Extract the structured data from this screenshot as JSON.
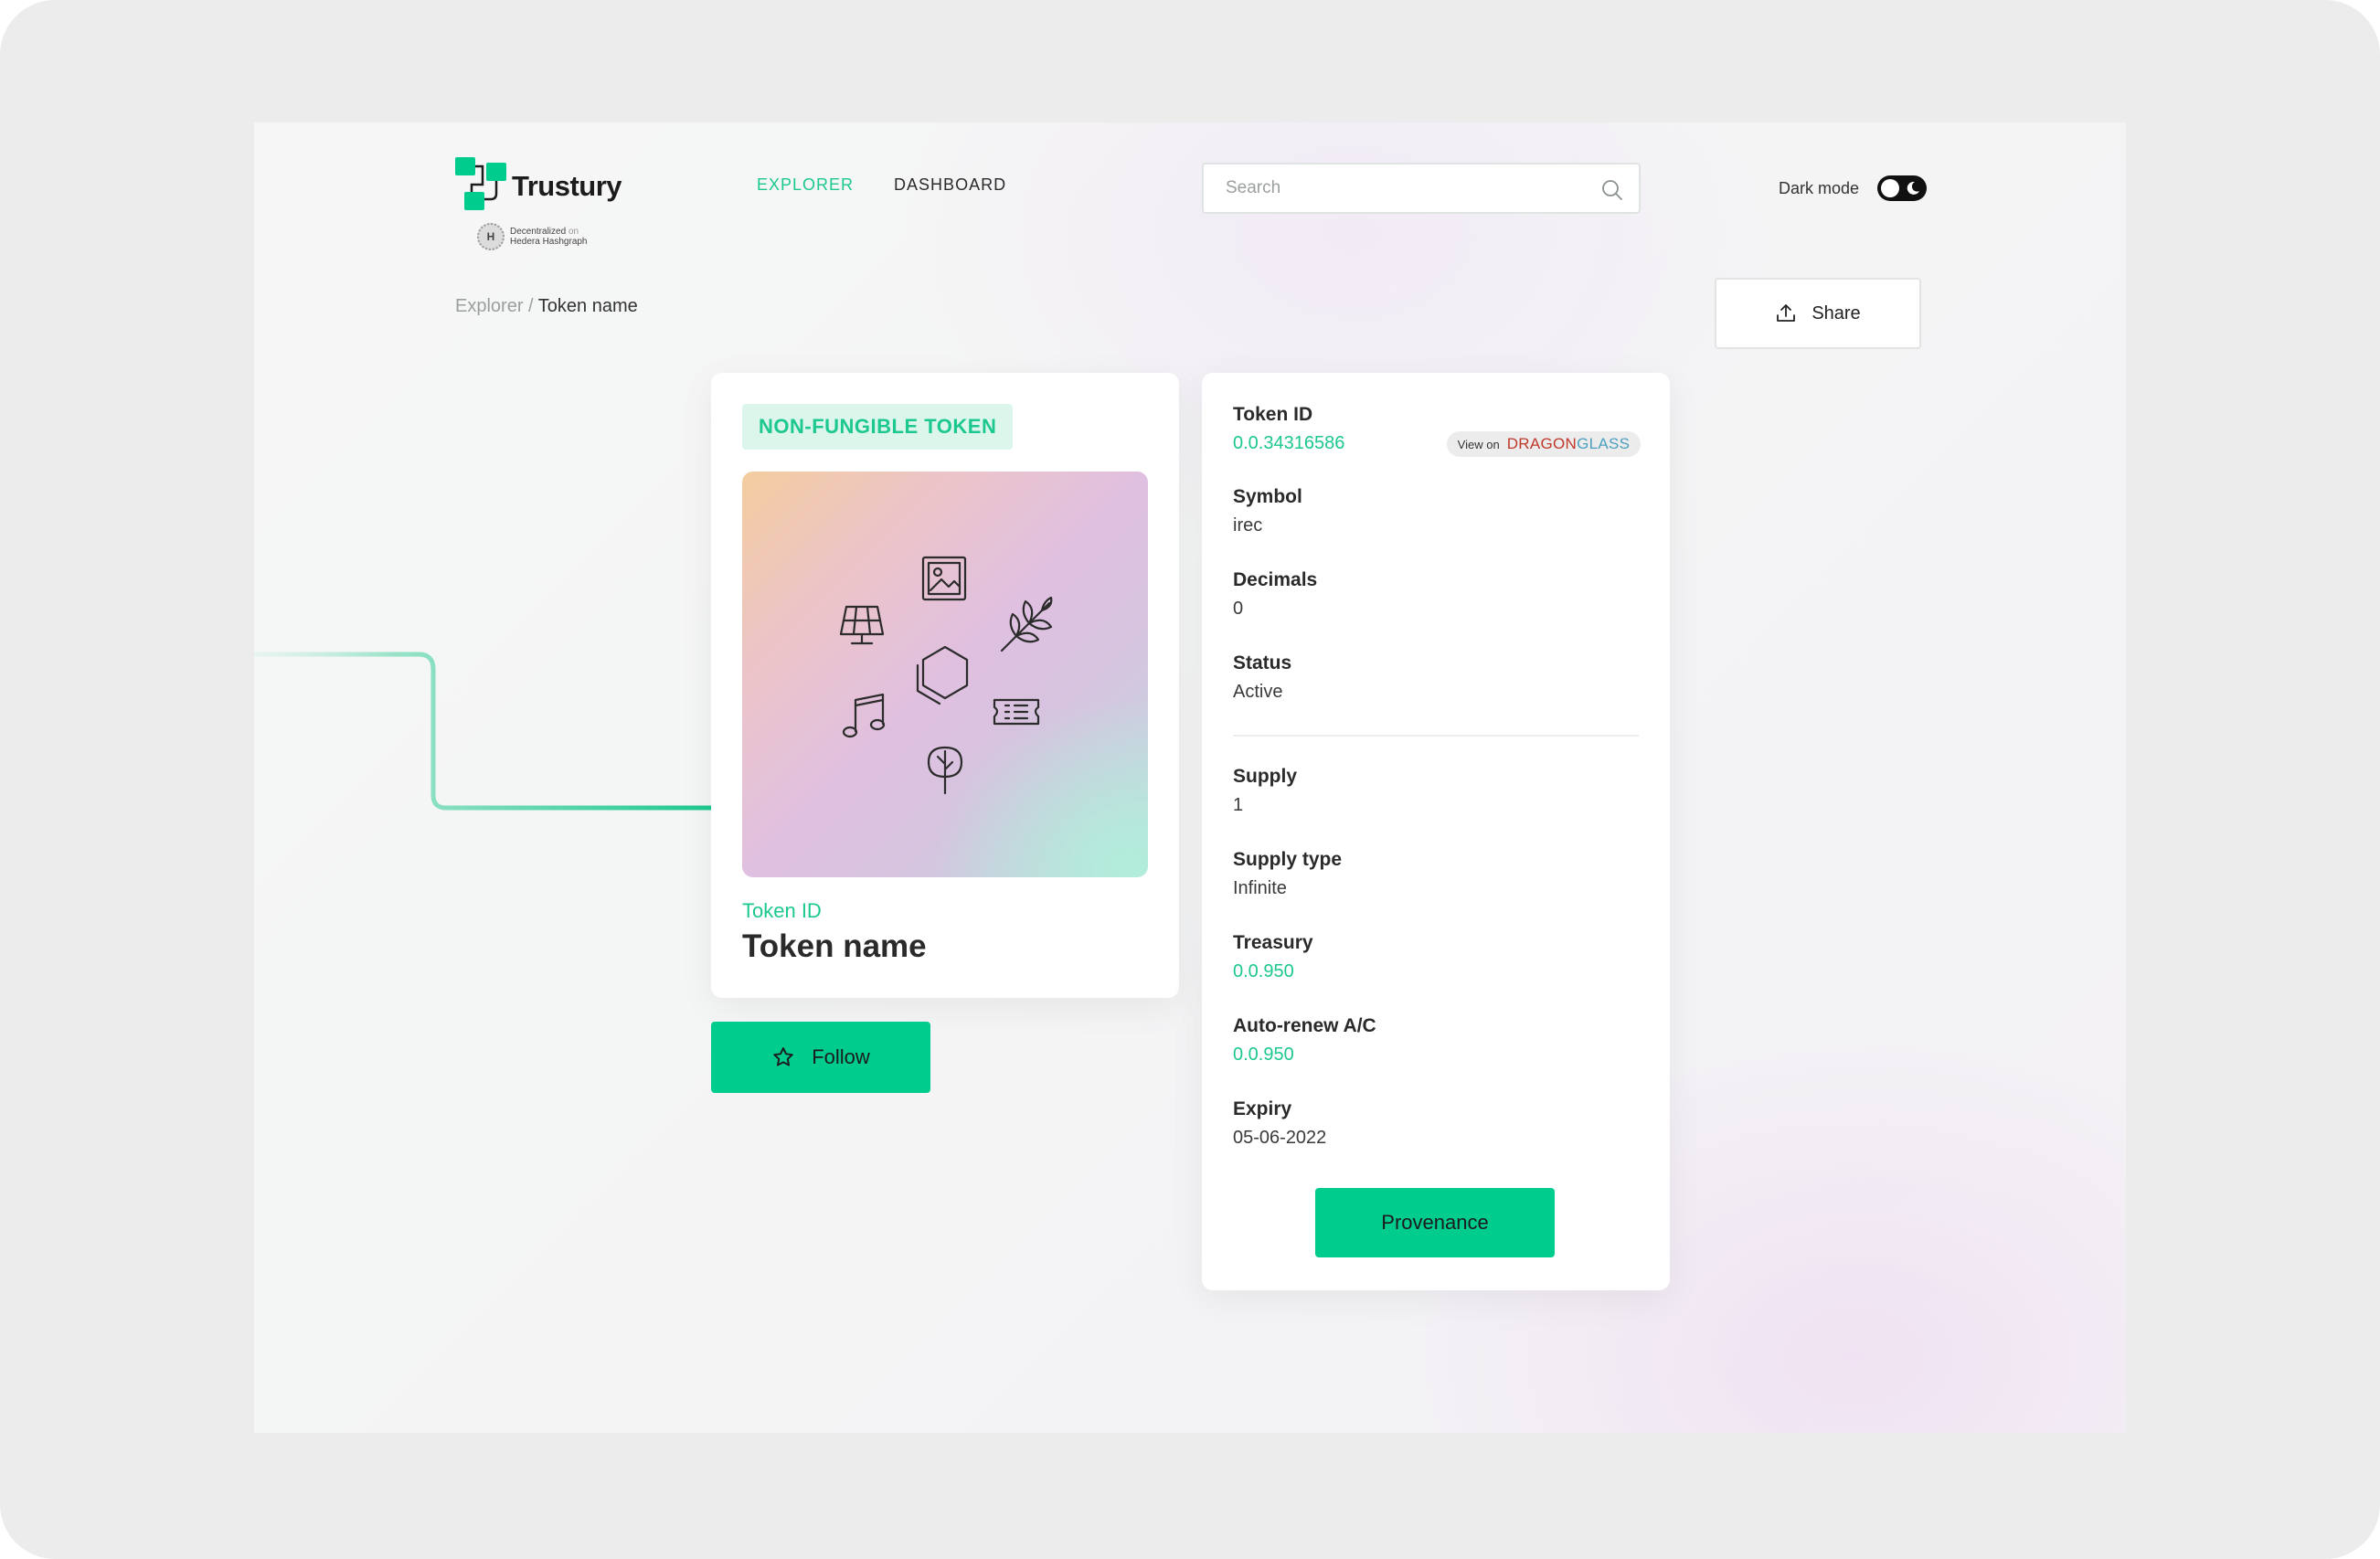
{
  "header": {
    "brand": "Trustury",
    "hedera_badge": {
      "line1": "Decentralized",
      "on": "on",
      "line2": "Hedera Hashgraph",
      "coin": "H"
    },
    "nav": [
      {
        "label": "EXPLORER",
        "active": true
      },
      {
        "label": "DASHBOARD",
        "active": false
      }
    ],
    "search": {
      "placeholder": "Search",
      "value": ""
    },
    "dark_mode": {
      "label": "Dark mode",
      "enabled": false
    }
  },
  "breadcrumb": {
    "root": "Explorer",
    "separator": " / ",
    "current": "Token name"
  },
  "share": {
    "label": "Share"
  },
  "token_card": {
    "badge": "NON-FUNGIBLE TOKEN",
    "token_id_label": "Token ID",
    "token_name": "Token name",
    "image_icons": [
      "picture-icon",
      "solar-panel-icon",
      "wheat-icon",
      "hexagon-icon",
      "music-note-icon",
      "ticket-icon",
      "tree-icon"
    ]
  },
  "follow": {
    "label": "Follow"
  },
  "details": {
    "token_id": {
      "label": "Token ID",
      "value": "0.0.34316586"
    },
    "dragonglass": {
      "prefix": "View on",
      "brand_red": "DRAGON",
      "brand_blue": "GLASS"
    },
    "symbol": {
      "label": "Symbol",
      "value": "irec"
    },
    "decimals": {
      "label": "Decimals",
      "value": "0"
    },
    "status": {
      "label": "Status",
      "value": "Active"
    },
    "supply": {
      "label": "Supply",
      "value": "1"
    },
    "supply_type": {
      "label": "Supply type",
      "value": "Infinite"
    },
    "treasury": {
      "label": "Treasury",
      "value": "0.0.950"
    },
    "auto_renew": {
      "label": "Auto-renew A/C",
      "value": "0.0.950"
    },
    "expiry": {
      "label": "Expiry",
      "value": "05-06-2022"
    },
    "provenance_label": "Provenance"
  },
  "colors": {
    "accent": "#00cc8e",
    "accent_text": "#1cc88f",
    "badge_bg": "#dcf6ec"
  }
}
